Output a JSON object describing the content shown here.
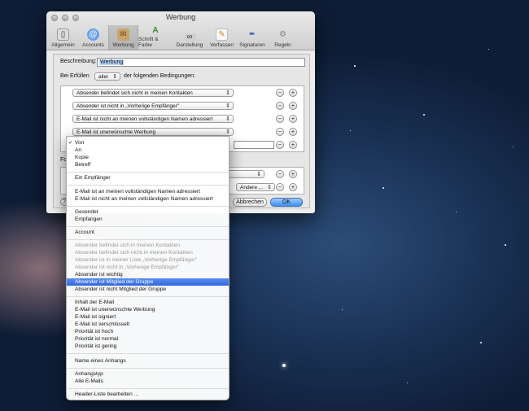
{
  "window": {
    "title": "Werbung"
  },
  "toolbar": [
    {
      "label": "Allgemein",
      "icon": "phone-switch-icon"
    },
    {
      "label": "Accounts",
      "icon": "at-sign-icon"
    },
    {
      "label": "Werbung",
      "icon": "stamp-icon"
    },
    {
      "label": "Schrift & Farbe",
      "icon": "fonts-icon"
    },
    {
      "label": "Darstellung",
      "icon": "glasses-icon"
    },
    {
      "label": "Verfassen",
      "icon": "pencil-paper-icon"
    },
    {
      "label": "Signaturen",
      "icon": "signature-pen-icon"
    },
    {
      "label": "Regeln",
      "icon": "rules-icon"
    }
  ],
  "form": {
    "description_label": "Beschreibung:",
    "description_value": "Werbung",
    "if_label": "Bei Erfüllen",
    "if_select": "aller",
    "if_suffix": "der folgenden Bedingungen:",
    "conditions": [
      "Absender befindet sich nicht in meinen Kontakten",
      "Absender ist nicht in „Vorherige Empfänger\"",
      "E-Mail ist nicht an meinen vollständigen Namen adressiert",
      "E-Mail ist unerwünschte Werbung"
    ],
    "actions_label": "Fo",
    "other_select": "Andere ...",
    "cancel": "Abbrechen",
    "ok": "OK",
    "help": "?"
  },
  "menu": {
    "groups": [
      [
        {
          "label": "Von",
          "checked": true
        },
        {
          "label": "An"
        },
        {
          "label": "Kopie"
        },
        {
          "label": "Betreff"
        }
      ],
      [
        {
          "label": "Ein Empfänger"
        }
      ],
      [
        {
          "label": "E-Mail ist an meinen vollständigen Namen adressiert"
        },
        {
          "label": "E-Mail ist nicht an meinen vollständigen Namen adressiert"
        }
      ],
      [
        {
          "label": "Gesendet"
        },
        {
          "label": "Empfangen"
        }
      ],
      [
        {
          "label": "Account"
        }
      ],
      [
        {
          "label": "Absender befindet sich in meinen Kontakten",
          "disabled": true
        },
        {
          "label": "Absender befindet sich nicht in meinen Kontakten",
          "disabled": true
        },
        {
          "label": "Absender ist in meiner Liste „Vorherige Empfänger\"",
          "disabled": true
        },
        {
          "label": "Absender ist nicht in „Vorherige Empfänger\"",
          "disabled": true
        },
        {
          "label": "Absender ist wichtig"
        },
        {
          "label": "Absender ist Mitglied der Gruppe",
          "highlighted": true
        },
        {
          "label": "Absender ist nicht Mitglied der Gruppe"
        }
      ],
      [
        {
          "label": "Inhalt der E-Mail"
        },
        {
          "label": "E-Mail ist unerwünschte Werbung"
        },
        {
          "label": "E-Mail ist signiert"
        },
        {
          "label": "E-Mail ist verschlüsselt"
        },
        {
          "label": "Priorität ist hoch"
        },
        {
          "label": "Priorität ist normal"
        },
        {
          "label": "Priorität ist gering"
        }
      ],
      [
        {
          "label": "Name eines Anhangs"
        }
      ],
      [
        {
          "label": "Anhangstyp"
        },
        {
          "label": "Alle E-Mails"
        }
      ],
      [
        {
          "label": "Header-Liste bearbeiten ..."
        }
      ]
    ]
  },
  "colors": {
    "accent": "#3167e0",
    "wallpaper": "#1b3357"
  }
}
